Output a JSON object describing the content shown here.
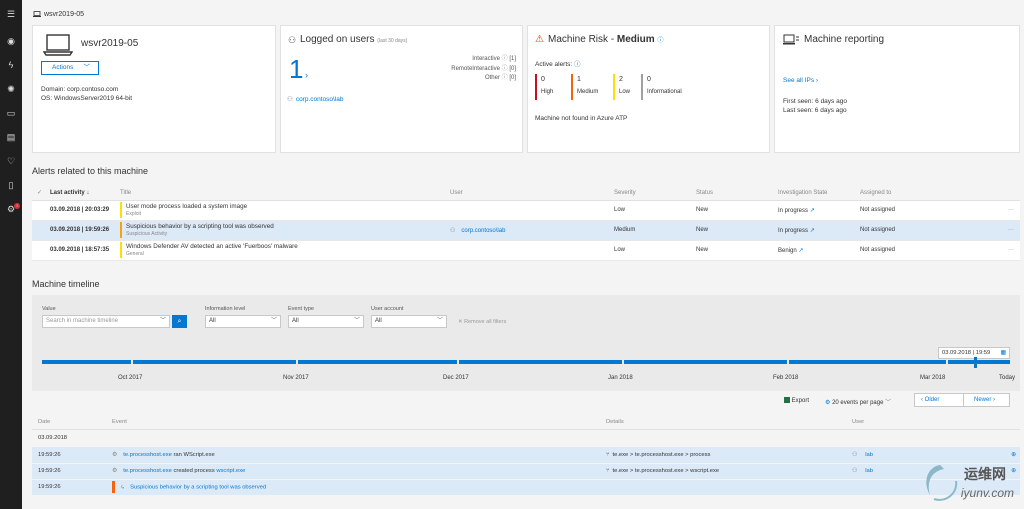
{
  "breadcrumb": "wsvr2019-05",
  "machine": {
    "name": "wsvr2019-05",
    "actions_label": "Actions",
    "domain": "Domain: corp.contoso.com",
    "os": "OS: WindowsServer2019 64-bit"
  },
  "logged_users": {
    "title": "Logged on users",
    "subtitle": "(last 30 days)",
    "count": "1",
    "types": [
      {
        "label": "Interactive",
        "value": "[1]"
      },
      {
        "label": "RemoteInteractive",
        "value": "[0]"
      },
      {
        "label": "Other",
        "value": "[0]"
      }
    ],
    "user": "corp.contoso\\lab"
  },
  "risk": {
    "title_prefix": "Machine Risk - ",
    "level": "Medium",
    "active_alerts_label": "Active alerts:",
    "buckets": [
      {
        "count": "0",
        "label": "High",
        "color": "#c50f1f"
      },
      {
        "count": "1",
        "label": "Medium",
        "color": "#f7630c"
      },
      {
        "count": "2",
        "label": "Low",
        "color": "#fce100"
      },
      {
        "count": "0",
        "label": "Informational",
        "color": "#a0a0a0"
      }
    ],
    "atp_note": "Machine not found in Azure ATP"
  },
  "reporting": {
    "title": "Machine reporting",
    "see_ips": "See all IPs",
    "first_seen": "First seen: 6 days ago",
    "last_seen": "Last seen: 6 days ago"
  },
  "alerts": {
    "title": "Alerts related to this machine",
    "columns": [
      "Last activity",
      "Title",
      "User",
      "Severity",
      "Status",
      "Investigation State",
      "Assigned to"
    ],
    "rows": [
      {
        "time": "03.09.2018 | 20:03:29",
        "title": "User mode process loaded a system image",
        "category": "Exploit",
        "user": "",
        "severity": "Low",
        "sev_color": "#fce100",
        "status": "New",
        "investigation": "In progress",
        "assigned": "Not assigned"
      },
      {
        "time": "03.09.2018 | 19:59:26",
        "title": "Suspicious behavior by a scripting tool was observed",
        "category": "Suspicious Activity",
        "user": "corp.contoso\\lab",
        "severity": "Medium",
        "sev_color": "#f7a30c",
        "status": "New",
        "investigation": "In progress",
        "assigned": "Not assigned"
      },
      {
        "time": "03.09.2018 | 18:57:35",
        "title": "Windows Defender AV detected an active 'Fuerboos' malware",
        "category": "General",
        "user": "",
        "severity": "Low",
        "sev_color": "#fce100",
        "status": "New",
        "investigation": "Benign",
        "assigned": "Not assigned"
      }
    ]
  },
  "timeline": {
    "title": "Machine timeline",
    "filters": {
      "value_label": "Value",
      "search_placeholder": "Search in machine timeline",
      "info_label": "Information level",
      "info_value": "All",
      "event_label": "Event type",
      "event_value": "All",
      "account_label": "User account",
      "account_value": "All",
      "remove_all": "Remove all filters"
    },
    "date_box": "03.09.2018 | 19:59",
    "months": [
      "Oct 2017",
      "Nov 2017",
      "Dec 2017",
      "Jan 2018",
      "Feb 2018",
      "Mar 2018",
      "Today"
    ],
    "export": "Export",
    "per_page": "20 events per page",
    "older": "Older",
    "newer": "Newer",
    "columns": [
      "Date",
      "Event",
      "Details",
      "User"
    ],
    "group_date": "03.09.2018",
    "events": [
      {
        "time": "19:59:26",
        "process": "te.processhost.exe",
        "action": " ran WScript.exe",
        "target": "",
        "details": "te.exe > te.processhost.exe > process",
        "user": "lab"
      },
      {
        "time": "19:59:26",
        "process": "te.processhost.exe",
        "action": " created process ",
        "target": "wscript.exe",
        "details": "te.exe > te.processhost.exe > wscript.exe",
        "user": "lab"
      },
      {
        "time": "19:59:26",
        "process": "Suspicious behavior by a scripting tool was observed",
        "action": "",
        "target": "",
        "details": "",
        "user": ""
      }
    ]
  },
  "watermark": {
    "brand": "运维网",
    "url": "iyunv.com"
  }
}
